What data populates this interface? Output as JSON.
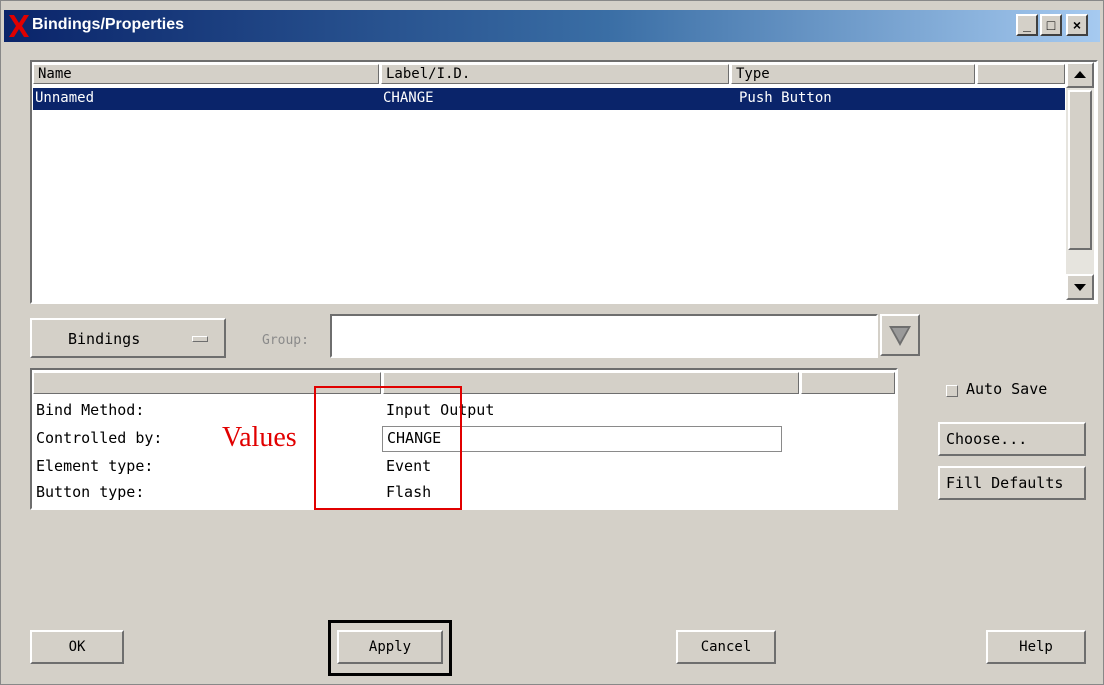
{
  "window": {
    "title": "Bindings/Properties"
  },
  "title_buttons": {
    "minimize": "_",
    "maximize": "□",
    "close": "×"
  },
  "list": {
    "columns": [
      "Name",
      "Label/I.D.",
      "Type"
    ],
    "rows": [
      {
        "name": "Unnamed",
        "label": "CHANGE",
        "type": "Push Button"
      }
    ]
  },
  "bindings_menu": {
    "selected": "Bindings"
  },
  "group": {
    "label": "Group:",
    "value": ""
  },
  "properties": {
    "rows": [
      {
        "label": "Bind Method:",
        "value": "Input Output"
      },
      {
        "label": "Controlled by:",
        "value": "CHANGE"
      },
      {
        "label": "Element type:",
        "value": "Event"
      },
      {
        "label": "Button type:",
        "value": "Flash"
      }
    ]
  },
  "annotation": {
    "text": "Values",
    "color": "#e10000"
  },
  "side": {
    "auto_save": "Auto Save",
    "choose": "Choose...",
    "fill_defaults": "Fill Defaults"
  },
  "buttons": {
    "ok": "OK",
    "apply": "Apply",
    "cancel": "Cancel",
    "help": "Help"
  },
  "colors": {
    "titlebar": "#0a246a",
    "selection": "#0a246a",
    "background": "#d4d0c8"
  }
}
